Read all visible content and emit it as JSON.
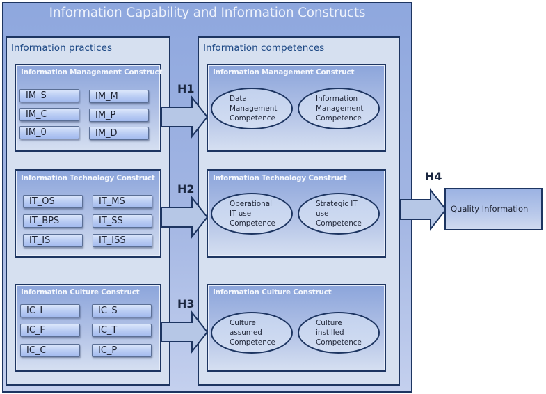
{
  "diagram": {
    "title": "Information Capability and Information Constructs",
    "left_panel": {
      "title": "Information practices",
      "constructs": [
        {
          "title": "Information Management Construct",
          "items": [
            "IM_S",
            "IM_M",
            "IM_C",
            "IM_P",
            "IM_0",
            "IM_D"
          ]
        },
        {
          "title": "Information Technology Construct",
          "items": [
            "IT_OS",
            "IT_MS",
            "IT_BPS",
            "IT_SS",
            "IT_IS",
            "IT_ISS"
          ]
        },
        {
          "title": "Information Culture Construct",
          "items": [
            "IC_I",
            "IC_S",
            "IC_F",
            "IC_T",
            "IC_C",
            "IC_P"
          ]
        }
      ]
    },
    "right_panel": {
      "title": "Information competences",
      "constructs": [
        {
          "title": "Information Management Construct",
          "competences": [
            {
              "lines": [
                "Data",
                "Management",
                "Competence"
              ]
            },
            {
              "lines": [
                "Information",
                "Management",
                "Competence"
              ]
            }
          ]
        },
        {
          "title": "Information Technology Construct",
          "competences": [
            {
              "lines": [
                "Operational",
                "IT use",
                "Competence"
              ]
            },
            {
              "lines": [
                "Strategic IT",
                "use",
                "Competence"
              ]
            }
          ]
        },
        {
          "title": "Information Culture Construct",
          "competences": [
            {
              "lines": [
                "Culture",
                "assumed",
                "Competence"
              ]
            },
            {
              "lines": [
                "Culture",
                "instilled",
                "Competence"
              ]
            }
          ]
        }
      ]
    },
    "hypotheses": [
      "H1",
      "H2",
      "H3",
      "H4"
    ],
    "outcome": "Quality Information"
  }
}
